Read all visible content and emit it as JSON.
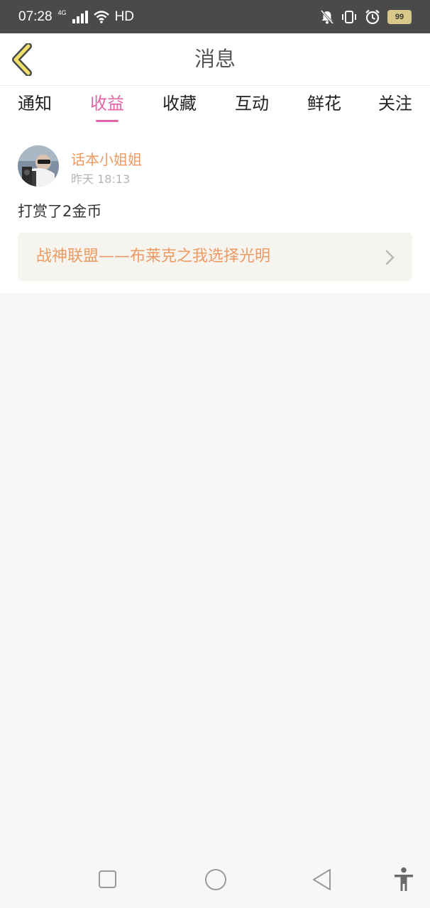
{
  "status_bar": {
    "time": "07:28",
    "network": "4G",
    "hd": "HD",
    "battery": "99"
  },
  "nav": {
    "title": "消息"
  },
  "tabs": [
    {
      "label": "通知",
      "active": false
    },
    {
      "label": "收益",
      "active": true
    },
    {
      "label": "收藏",
      "active": false
    },
    {
      "label": "互动",
      "active": false
    },
    {
      "label": "鲜花",
      "active": false
    },
    {
      "label": "关注",
      "active": false
    }
  ],
  "message": {
    "user_name": "话本小姐姐",
    "timestamp": "昨天 18:13",
    "text": "打赏了2金币",
    "book_title": "战神联盟——布莱克之我选择光明"
  },
  "colors": {
    "accent_pink": "#e463a6",
    "accent_orange": "#ef9a63",
    "status_bar_bg": "#4a4a4a",
    "page_bg": "#f8f7f7",
    "link_card_bg": "#f5f4ee"
  }
}
